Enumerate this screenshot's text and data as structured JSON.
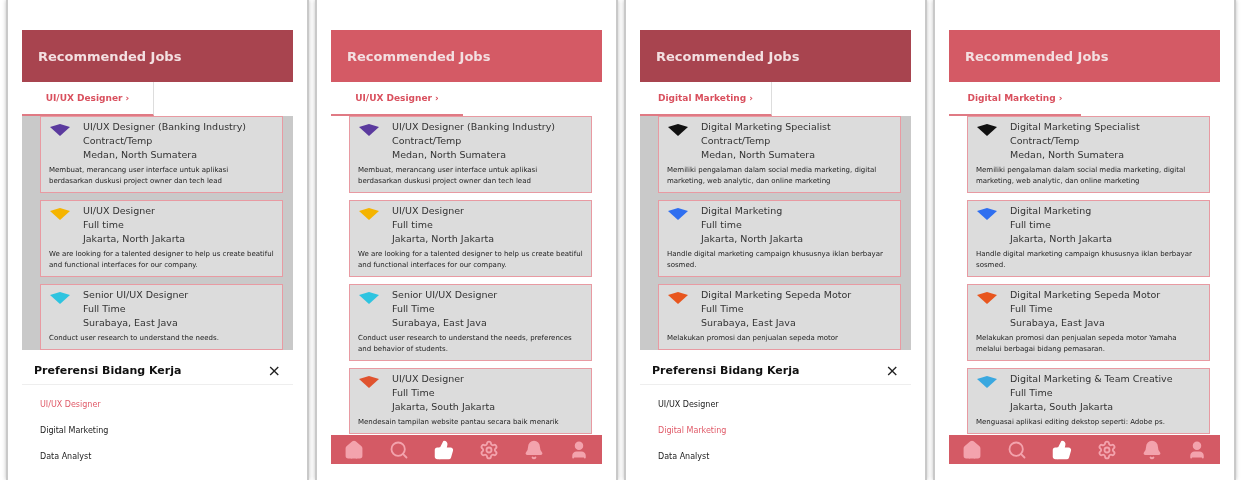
{
  "screens": [
    {
      "dimmed": true,
      "header": {
        "title": "Recommended Jobs"
      },
      "filter_tab": {
        "label": "UI/UX Designer ›"
      },
      "jobs": [
        {
          "title": "UI/UX Designer (Banking Industry)",
          "type": "Contract/Temp",
          "location": "Medan, North Sumatera",
          "description": "Membuat, merancang user interface untuk aplikasi berdasarkan duskusi project owner dan tech lead",
          "color": "#5b3a9e"
        },
        {
          "title": "UI/UX Designer",
          "type": "Full time",
          "location": "Jakarta, North Jakarta",
          "description": "We are looking for a talented designer to help us create beatiful and functional interfaces for our company.",
          "color": "#f5b400"
        },
        {
          "title": "Senior UI/UX Designer",
          "type": "Full Time",
          "location": "Surabaya, East Java",
          "description": "Conduct user research to understand the needs.",
          "color": "#2ec4e0"
        }
      ],
      "sheet": {
        "title": "Preferensi Bidang Kerja",
        "close": "×",
        "options": [
          {
            "label": "UI/UX Designer",
            "selected": true
          },
          {
            "label": "Digital Marketing",
            "selected": false
          },
          {
            "label": "Data Analyst",
            "selected": false
          }
        ]
      }
    },
    {
      "dimmed": false,
      "header": {
        "title": "Recommended Jobs"
      },
      "filter_tab": {
        "label": "UI/UX Designer ›"
      },
      "jobs": [
        {
          "title": "UI/UX Designer (Banking Industry)",
          "type": "Contract/Temp",
          "location": "Medan, North Sumatera",
          "description": "Membuat, merancang user interface untuk aplikasi berdasarkan duskusi project owner dan tech lead",
          "color": "#5b3a9e"
        },
        {
          "title": "UI/UX Designer",
          "type": "Full time",
          "location": "Jakarta, North Jakarta",
          "description": "We are looking for a talented designer to help us create beatiful and functional interfaces for our company.",
          "color": "#f5b400"
        },
        {
          "title": "Senior UI/UX Designer",
          "type": "Full Time",
          "location": "Surabaya, East Java",
          "description": "Conduct user research to understand the needs, preferences and behavior of students.",
          "color": "#2ec4e0"
        },
        {
          "title": "UI/UX Designer",
          "type": "Full Time",
          "location": "Jakarta, South Jakarta",
          "description": "Mendesain tampilan website pantau secara baik menarik",
          "color": "#e0532f"
        }
      ],
      "nav": [
        {
          "selected": false
        },
        {
          "selected": false
        },
        {
          "selected": true
        },
        {
          "selected": false
        },
        {
          "selected": false
        },
        {
          "selected": false
        }
      ]
    },
    {
      "dimmed": true,
      "header": {
        "title": "Recommended Jobs"
      },
      "filter_tab": {
        "label": "Digital Marketing ›"
      },
      "jobs": [
        {
          "title": "Digital Marketing Specialist",
          "type": "Contract/Temp",
          "location": "Medan, North Sumatera",
          "description": "Memiliki pengalaman dalam social media marketing, digital marketing, web analytic, dan online marketing",
          "color": "#111111"
        },
        {
          "title": "Digital Marketing",
          "type": "Full time",
          "location": "Jakarta, North Jakarta",
          "description": "Handle digital marketing campaign khususnya iklan berbayar sosmed.",
          "color": "#2f6ff0"
        },
        {
          "title": "Digital Marketing Sepeda Motor",
          "type": "Full Time",
          "location": "Surabaya, East Java",
          "description": "Melakukan promosi dan penjualan sepeda motor",
          "color": "#e8561e"
        }
      ],
      "sheet": {
        "title": "Preferensi Bidang Kerja",
        "close": "×",
        "options": [
          {
            "label": "UI/UX Designer",
            "selected": false
          },
          {
            "label": "Digital Marketing",
            "selected": true
          },
          {
            "label": "Data Analyst",
            "selected": false
          }
        ]
      }
    },
    {
      "dimmed": false,
      "header": {
        "title": "Recommended Jobs"
      },
      "filter_tab": {
        "label": "Digital Marketing ›"
      },
      "jobs": [
        {
          "title": "Digital Marketing Specialist",
          "type": "Contract/Temp",
          "location": "Medan, North Sumatera",
          "description": "Memiliki pengalaman dalam social media marketing, digital marketing, web analytic, dan online marketing",
          "color": "#111111"
        },
        {
          "title": "Digital Marketing",
          "type": "Full time",
          "location": "Jakarta, North Jakarta",
          "description": "Handle digital marketing campaign khususnya iklan berbayar sosmed.",
          "color": "#2f6ff0"
        },
        {
          "title": "Digital Marketing Sepeda Motor",
          "type": "Full Time",
          "location": "Surabaya, East Java",
          "description": "Melakukan promosi dan penjualan sepeda motor Yamaha melalui berbagai bidang pemasaran.",
          "color": "#e8561e"
        },
        {
          "title": "Digital Marketing & Team Creative",
          "type": "Full Time",
          "location": "Jakarta, South Jakarta",
          "description": "Menguasai aplikasi editing dekstop seperti: Adobe ps.",
          "color": "#3aa8e0"
        }
      ],
      "nav": [
        {
          "selected": false
        },
        {
          "selected": false
        },
        {
          "selected": true
        },
        {
          "selected": false
        },
        {
          "selected": false
        },
        {
          "selected": false
        }
      ]
    }
  ]
}
